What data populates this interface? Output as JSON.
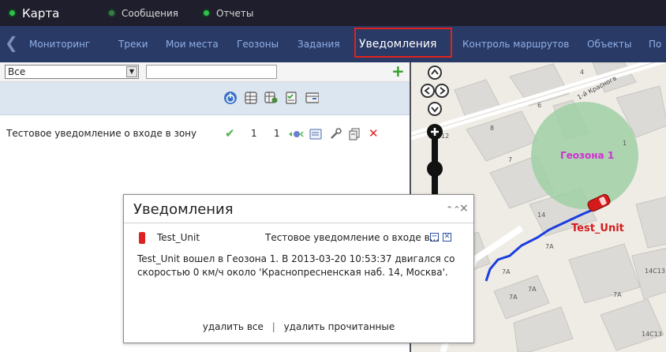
{
  "topbar": {
    "map_label": "Карта",
    "messages_label": "Сообщения",
    "reports_label": "Отчеты"
  },
  "nav": {
    "items": [
      {
        "label": "Мониторинг"
      },
      {
        "label": "Треки"
      },
      {
        "label": "Мои места"
      },
      {
        "label": "Геозоны"
      },
      {
        "label": "Задания"
      },
      {
        "label": "Уведомления"
      },
      {
        "label": "Контроль маршрутов"
      },
      {
        "label": "Объекты"
      },
      {
        "label": "По"
      }
    ]
  },
  "filter": {
    "selected": "Все",
    "search_value": "",
    "add_label": "+"
  },
  "notification_row": {
    "name": "Тестовое уведомление о входе в зону",
    "count_a": "1",
    "count_b": "1"
  },
  "map": {
    "geozone_label": "Геозона 1",
    "unit_label": "Test_Unit",
    "street_label": "1-й Красногв",
    "house_numbers": [
      "4",
      "6",
      "8",
      "12",
      "7",
      "1",
      "14",
      "7А",
      "7А",
      "7А",
      "7А",
      "14С13",
      "7А",
      "14С13"
    ]
  },
  "popup": {
    "title": "Уведомления",
    "collapse_glyph": "»",
    "close_glyph": "×",
    "unit_name": "Test_Unit",
    "preview": "Тестовое уведомление о входе в...",
    "message": "Test_Unit вошел в Геозона 1. В 2013-03-20 10:53:37 двигался со скоростью 0 км/ч около 'Краснопресненская наб. 14, Москва'.",
    "delete_all": "удалить все",
    "separator": "|",
    "delete_read": "удалить прочитанные"
  },
  "colors": {
    "topbar_bg": "#1f1e2c",
    "navbar_bg": "#2a3a66",
    "nav_text": "#8fb0e6",
    "active_outline": "#e0221a",
    "geozone_fill": "#9fd0a4",
    "geozone_label": "#d22fd2",
    "unit_label": "#d41a1a",
    "track": "#1a3ee0"
  }
}
